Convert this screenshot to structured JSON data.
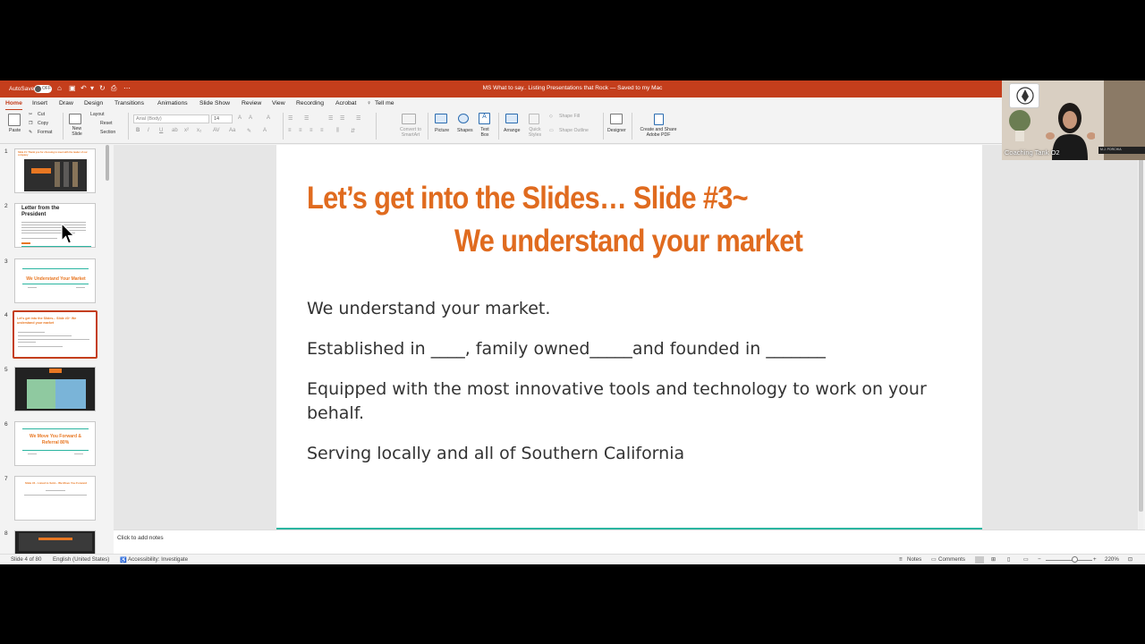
{
  "titlebar": {
    "autosave": "AutoSave",
    "autosave_state": "OFF",
    "document_title": "MS What to say.. Listing Presentations that Rock — Saved to my Mac"
  },
  "tabs": [
    "Home",
    "Insert",
    "Draw",
    "Design",
    "Transitions",
    "Animations",
    "Slide Show",
    "Review",
    "View",
    "Recording",
    "Acrobat",
    "Tell me"
  ],
  "ribbon": {
    "paste": "Paste",
    "cut": "Cut",
    "copy": "Copy",
    "format": "Format",
    "new_slide": "New Slide",
    "layout": "Layout",
    "reset": "Reset",
    "section": "Section",
    "font": "Arial (Body)",
    "size": "14",
    "convert_smartart": "Convert to SmartArt",
    "picture": "Picture",
    "shapes": "Shapes",
    "text_box": "Text Box",
    "arrange": "Arrange",
    "quick_styles": "Quick Styles",
    "shape_fill": "Shape Fill",
    "shape_outline": "Shape Outline",
    "designer": "Designer",
    "create_share_pdf": "Create and Share Adobe PDF"
  },
  "thumbnails": [
    {
      "num": "1",
      "text": "Slide #1: Thank you for choosing to meet with the leader of our company"
    },
    {
      "num": "2",
      "text": "Letter from the President"
    },
    {
      "num": "3",
      "text": "We Understand Your Market"
    },
    {
      "num": "4",
      "text": "Let's get into the Slides... Slide #3~ We understand your market"
    },
    {
      "num": "5",
      "text": ""
    },
    {
      "num": "6",
      "text": "We Move You Forward & Referral 80%"
    },
    {
      "num": "7",
      "text": "Slide #4 - Listed to Sold... We Move You Forward"
    },
    {
      "num": "8",
      "text": ""
    }
  ],
  "slide": {
    "title_line1": "Let’s get into the Slides… Slide #3~",
    "title_line2": "We understand your market",
    "bullets": [
      "We understand your market.",
      "Established in ____, family owned_____and founded in _______",
      "Equipped with the most innovative  tools and technology to work on your behalf.",
      "Serving locally and all of Southern California"
    ]
  },
  "notes_placeholder": "Click to add notes",
  "status": {
    "slide_of": "Slide 4 of 80",
    "language": "English (United States)",
    "accessibility": "Accessibility: Investigate",
    "notes": "Notes",
    "comments": "Comments",
    "zoom": "220%"
  },
  "video": {
    "name": "Coaching Tank O2",
    "nameplate": "M.J. PORCHIA"
  },
  "colors": {
    "accent": "#c43e1c",
    "slide_title": "#e06b1f",
    "teal_rule": "#2ab5a0"
  }
}
